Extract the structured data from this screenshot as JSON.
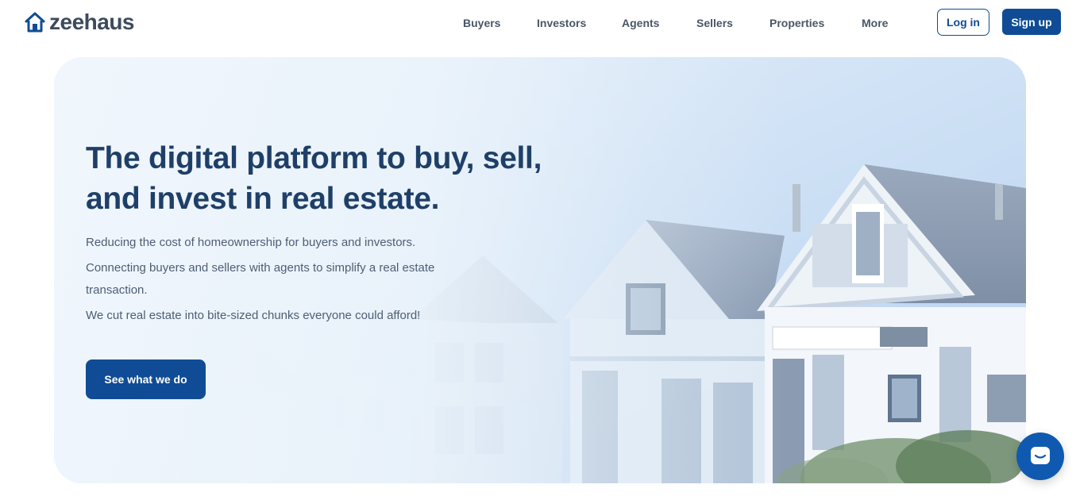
{
  "brand": {
    "name": "zeehaus",
    "accent": "#0f4c95"
  },
  "nav": {
    "items": [
      "Buyers",
      "Investors",
      "Agents",
      "Sellers",
      "Properties",
      "More"
    ],
    "login_label": "Log in",
    "signup_label": "Sign up"
  },
  "hero": {
    "title": "The digital platform to buy, sell, and invest in real estate.",
    "lines": [
      "Reducing the cost of homeownership for buyers and investors.",
      "Connecting buyers and sellers with agents to simplify a real estate transaction.",
      "We cut real estate into bite-sized chunks everyone could afford!"
    ],
    "cta_label": "See what we do",
    "image": "victorian-row-houses-photo"
  },
  "chat": {
    "icon": "chat-bubble-icon"
  }
}
